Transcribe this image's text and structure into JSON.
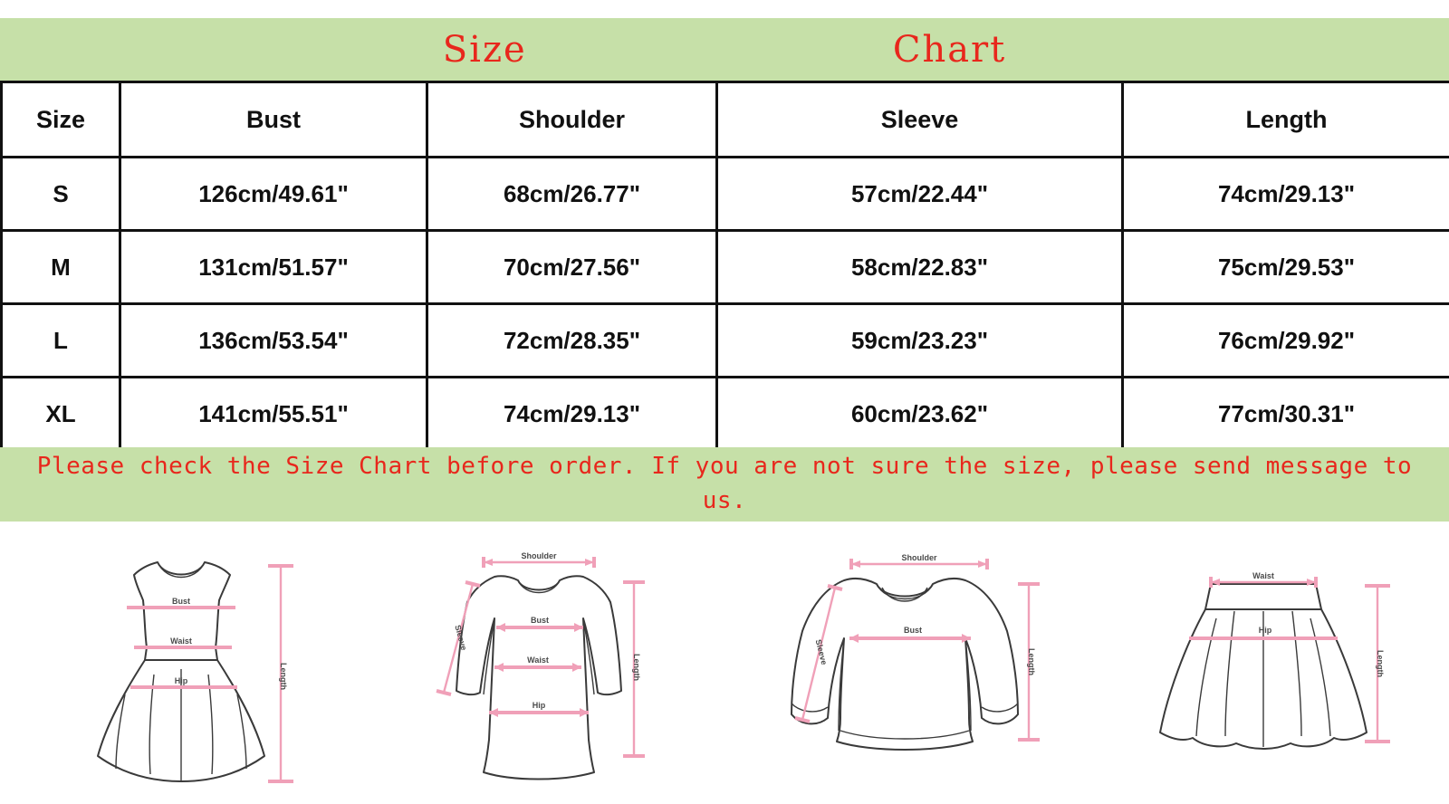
{
  "title": "Size   Chart",
  "colors": {
    "band_green": "#c6e0a8",
    "accent_red": "#e8271c",
    "measure_pink": "#f0a0b8",
    "garment_outline": "#3a3a3a",
    "table_border": "#111111"
  },
  "table": {
    "columns": [
      "Size",
      "Bust",
      "Shoulder",
      "Sleeve",
      "Length"
    ],
    "rows": [
      {
        "size": "S",
        "bust": "126cm/49.61\"",
        "shoulder": "68cm/26.77\"",
        "sleeve": "57cm/22.44\"",
        "length": "74cm/29.13\""
      },
      {
        "size": "M",
        "bust": "131cm/51.57\"",
        "shoulder": "70cm/27.56\"",
        "sleeve": "58cm/22.83\"",
        "length": "75cm/29.53\""
      },
      {
        "size": "L",
        "bust": "136cm/53.54\"",
        "shoulder": "72cm/28.35\"",
        "sleeve": "59cm/23.23\"",
        "length": "76cm/29.92\""
      },
      {
        "size": "XL",
        "bust": "141cm/55.51\"",
        "shoulder": "74cm/29.13\"",
        "sleeve": "60cm/23.62\"",
        "length": "77cm/30.31\""
      }
    ]
  },
  "note": "Please check the Size Chart before order. If you are not sure the size, please send message to us.",
  "diagrams": [
    {
      "name": "dress",
      "labels": {
        "bust": "Bust",
        "waist": "Waist",
        "hip": "Hip",
        "length": "Length"
      }
    },
    {
      "name": "long-sleeve-tunic",
      "labels": {
        "shoulder": "Shoulder",
        "sleeve": "Sleeve",
        "bust": "Bust",
        "waist": "Waist",
        "hip": "Hip",
        "length": "Length"
      }
    },
    {
      "name": "sweatshirt",
      "labels": {
        "shoulder": "Shoulder",
        "sleeve": "Sleeve",
        "bust": "Bust",
        "length": "Length"
      }
    },
    {
      "name": "skirt",
      "labels": {
        "waist": "Waist",
        "hip": "Hip",
        "length": "Length"
      }
    }
  ],
  "chart_data": {
    "type": "table",
    "title": "Size Chart",
    "columns": [
      "Size",
      "Bust",
      "Shoulder",
      "Sleeve",
      "Length"
    ],
    "unit_primary": "cm",
    "unit_secondary": "inch",
    "rows": [
      [
        "S",
        "126cm/49.61\"",
        "68cm/26.77\"",
        "57cm/22.44\"",
        "74cm/29.13\""
      ],
      [
        "M",
        "131cm/51.57\"",
        "70cm/27.56\"",
        "58cm/22.83\"",
        "75cm/29.53\""
      ],
      [
        "L",
        "136cm/53.54\"",
        "72cm/28.35\"",
        "59cm/23.23\"",
        "76cm/29.92\""
      ],
      [
        "XL",
        "141cm/55.51\"",
        "74cm/29.13\"",
        "60cm/23.62\"",
        "77cm/30.31\""
      ]
    ],
    "numeric": {
      "sizes": [
        "S",
        "M",
        "L",
        "XL"
      ],
      "bust_cm": [
        126,
        131,
        136,
        141
      ],
      "bust_in": [
        49.61,
        51.57,
        53.54,
        55.51
      ],
      "shoulder_cm": [
        68,
        70,
        72,
        74
      ],
      "shoulder_in": [
        26.77,
        27.56,
        28.35,
        29.13
      ],
      "sleeve_cm": [
        57,
        58,
        59,
        60
      ],
      "sleeve_in": [
        22.44,
        22.83,
        23.23,
        23.62
      ],
      "length_cm": [
        74,
        75,
        76,
        77
      ],
      "length_in": [
        29.13,
        29.53,
        29.92,
        30.31
      ]
    }
  }
}
